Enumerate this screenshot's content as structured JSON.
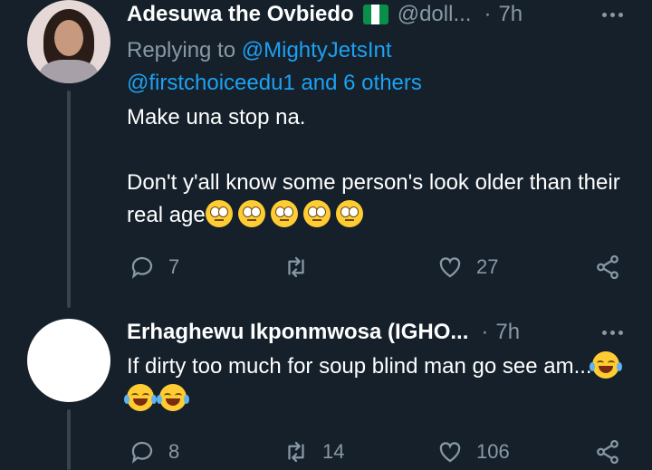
{
  "tweets": [
    {
      "author_name": "Adesuwa the Ovbiedo",
      "handle": "@doll...",
      "separator": "·",
      "time": "7h",
      "replying_prefix": "Replying to ",
      "replying_user": "@MightyJetsInt",
      "replying_rest": "@firstchoiceedu1 and 6 others",
      "text_line1": "Make una stop na.",
      "text_line2": "Don't y'all know some person's look older than their real age",
      "emojis": [
        "face-with-rolling-eyes",
        "face-with-rolling-eyes",
        "face-with-rolling-eyes",
        "face-with-rolling-eyes",
        "face-with-rolling-eyes"
      ],
      "reply_count": "7",
      "retweet_count": "",
      "like_count": "27",
      "flag_colors": [
        "#0a8f4a",
        "#ffffff",
        "#0a8f4a"
      ]
    },
    {
      "author_name": "Erhaghewu Ikponmwosa (IGHO...",
      "separator": "·",
      "time": "7h",
      "text": "If dirty too much for soup blind man go see am...",
      "emojis": [
        "face-with-tears-of-joy",
        "face-with-tears-of-joy",
        "face-with-tears-of-joy"
      ],
      "reply_count": "8",
      "retweet_count": "14",
      "like_count": "106"
    }
  ],
  "icons": [
    "reply-icon",
    "retweet-icon",
    "like-icon",
    "share-icon",
    "more-icon"
  ],
  "colors": {
    "background": "#15202b",
    "secondary_text": "#8899a6",
    "link": "#1da1f2",
    "thread_line": "#38444d"
  }
}
